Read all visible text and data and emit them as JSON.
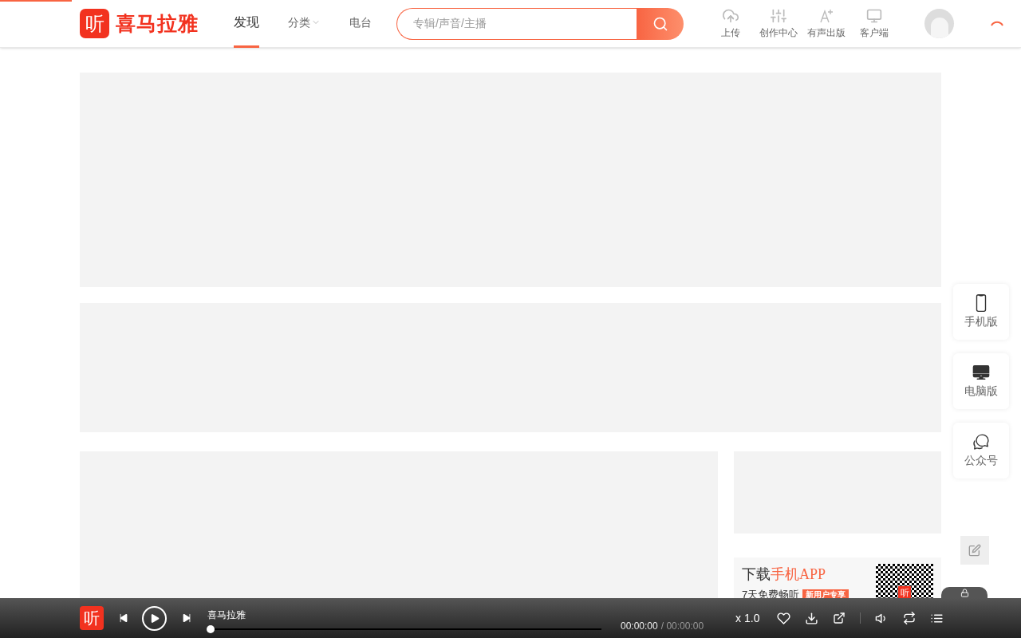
{
  "header": {
    "logo_glyph": "听",
    "logo_text": "喜马拉雅",
    "nav": [
      {
        "label": "发现",
        "selected": true,
        "dropdown": false
      },
      {
        "label": "分类",
        "selected": false,
        "dropdown": true
      },
      {
        "label": "电台",
        "selected": false,
        "dropdown": false
      }
    ],
    "search": {
      "placeholder": "专辑/声音/主播"
    },
    "tools": [
      {
        "kind": "upload",
        "label": "上传"
      },
      {
        "kind": "studio",
        "label": "创作中心"
      },
      {
        "kind": "publish",
        "label": "有声出版"
      },
      {
        "kind": "client",
        "label": "客户端"
      }
    ]
  },
  "side_panel": [
    {
      "kind": "phone",
      "label": "手机版"
    },
    {
      "kind": "desktop",
      "label": "电脑版"
    },
    {
      "kind": "wechat",
      "label": "公众号"
    }
  ],
  "app_card": {
    "title": "下载",
    "title_highlight": "手机APP",
    "line_1": "7天免费畅听",
    "badge": "新用户专享",
    "qr_glyph": "听"
  },
  "player": {
    "logo_glyph": "听",
    "track": "喜马拉雅",
    "level": 0,
    "elapsed": "00:00:00",
    "total": "/ 00:00:00",
    "speed": "x 1.0"
  }
}
